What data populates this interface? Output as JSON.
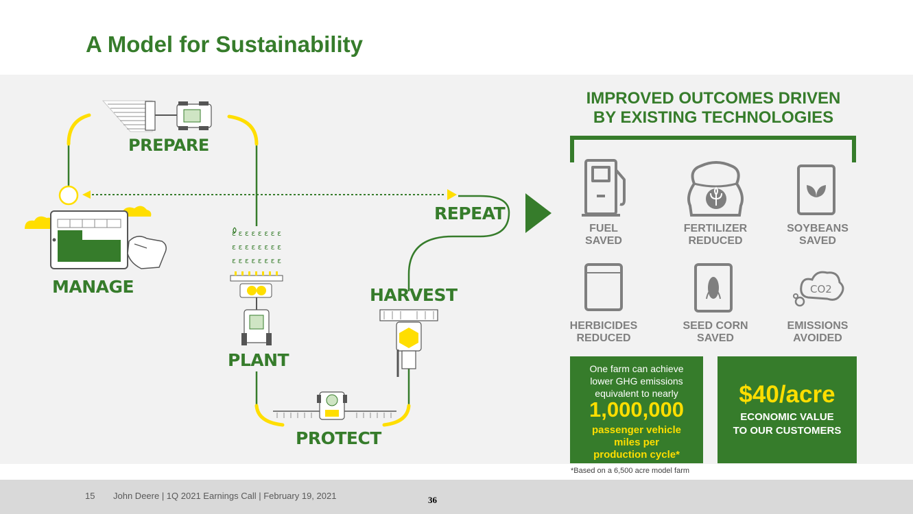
{
  "title": "A Model for Sustainability",
  "stages": {
    "prepare": "PREPARE",
    "manage": "MANAGE",
    "plant": "PLANT",
    "protect": "PROTECT",
    "harvest": "HARVEST",
    "repeat": "REPEAT"
  },
  "outcomes": {
    "heading_line1": "IMPROVED OUTCOMES DRIVEN",
    "heading_line2": "BY EXISTING TECHNOLOGIES",
    "items": [
      {
        "icon": "fuel-pump-icon",
        "line1": "FUEL",
        "line2": "SAVED"
      },
      {
        "icon": "fertilizer-bag-icon",
        "line1": "FERTILIZER",
        "line2": "REDUCED"
      },
      {
        "icon": "soybean-bag-icon",
        "line1": "SOYBEANS",
        "line2": "SAVED"
      },
      {
        "icon": "herbicide-bag-icon",
        "line1": "HERBICIDES",
        "line2": "REDUCED"
      },
      {
        "icon": "seed-corn-bag-icon",
        "line1": "SEED CORN",
        "line2": "SAVED"
      },
      {
        "icon": "co2-cloud-icon",
        "line1": "EMISSIONS",
        "line2": "AVOIDED"
      }
    ]
  },
  "ghg_box": {
    "line1": "One farm can achieve",
    "line2": "lower GHG emissions",
    "line3": "equivalent to nearly",
    "big_number": "1,000,000",
    "sub1": "passenger vehicle",
    "sub2": "miles per",
    "sub3": "production cycle*"
  },
  "value_box": {
    "big_value": "$40/acre",
    "sub1": "ECONOMIC VALUE",
    "sub2": "TO OUR CUSTOMERS"
  },
  "footnote": "*Based on a 6,500 acre model farm",
  "footer": {
    "page_number": "15",
    "text": "John Deere | 1Q 2021 Earnings Call | February 19, 2021",
    "slide_number": "36"
  },
  "colors": {
    "brand_green": "#367C2B",
    "brand_yellow": "#FFDE00",
    "icon_gray": "#7f7f7f",
    "panel_bg": "#f2f2f2"
  }
}
